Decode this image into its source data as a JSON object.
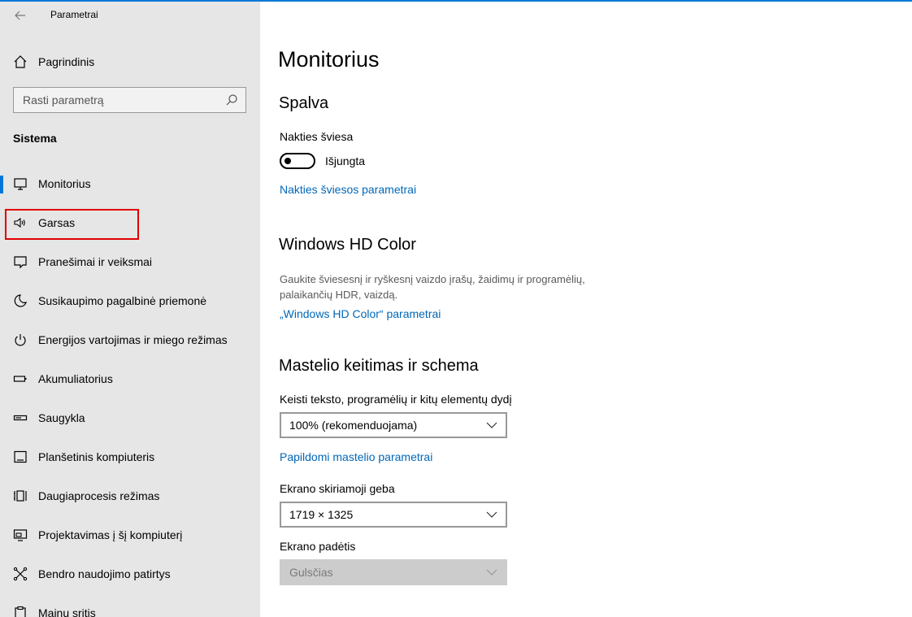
{
  "window": {
    "title": "Parametrai"
  },
  "sidebar": {
    "home_label": "Pagrindinis",
    "search_placeholder": "Rasti parametrą",
    "section_label": "Sistema",
    "items": [
      {
        "label": "Monitorius",
        "icon": "monitor-icon",
        "active": true
      },
      {
        "label": "Garsas",
        "icon": "speaker-icon"
      },
      {
        "label": "Pranešimai ir veiksmai",
        "icon": "notification-icon"
      },
      {
        "label": "Susikaupimo pagalbinė priemonė",
        "icon": "moon-icon"
      },
      {
        "label": "Energijos vartojimas ir miego režimas",
        "icon": "power-icon"
      },
      {
        "label": "Akumuliatorius",
        "icon": "battery-icon"
      },
      {
        "label": "Saugykla",
        "icon": "storage-icon"
      },
      {
        "label": "Planšetinis kompiuteris",
        "icon": "tablet-icon"
      },
      {
        "label": "Daugiaprocesis režimas",
        "icon": "multitasking-icon"
      },
      {
        "label": "Projektavimas į šį kompiuterį",
        "icon": "projecting-icon"
      },
      {
        "label": "Bendro naudojimo patirtys",
        "icon": "shared-experiences-icon"
      },
      {
        "label": "Mainų sritis",
        "icon": "clipboard-icon"
      }
    ]
  },
  "main": {
    "page_title": "Monitorius",
    "color": {
      "heading": "Spalva",
      "night_light_label": "Nakties šviesa",
      "toggle_state": "Išjungta",
      "night_light_link": "Nakties šviesos parametrai"
    },
    "hd_color": {
      "heading": "Windows HD Color",
      "description": "Gaukite šviesesnį ir ryškesnį vaizdo įrašų, žaidimų ir programėlių, palaikančių HDR, vaizdą.",
      "link": "„Windows HD Color“ parametrai"
    },
    "scale": {
      "heading": "Mastelio keitimas ir schema",
      "scale_label": "Keisti teksto, programėlių ir kitų elementų dydį",
      "scale_value": "100% (rekomenduojama)",
      "advanced_link": "Papildomi mastelio parametrai",
      "resolution_label": "Ekrano skiriamoji geba",
      "resolution_value": "1719 × 1325",
      "orientation_label": "Ekrano padėtis",
      "orientation_value": "Gulsčias"
    }
  },
  "colors": {
    "accent": "#0078d7",
    "link": "#0067b8",
    "sidebar_bg": "#e6e6e6",
    "highlight": "#e00000"
  }
}
